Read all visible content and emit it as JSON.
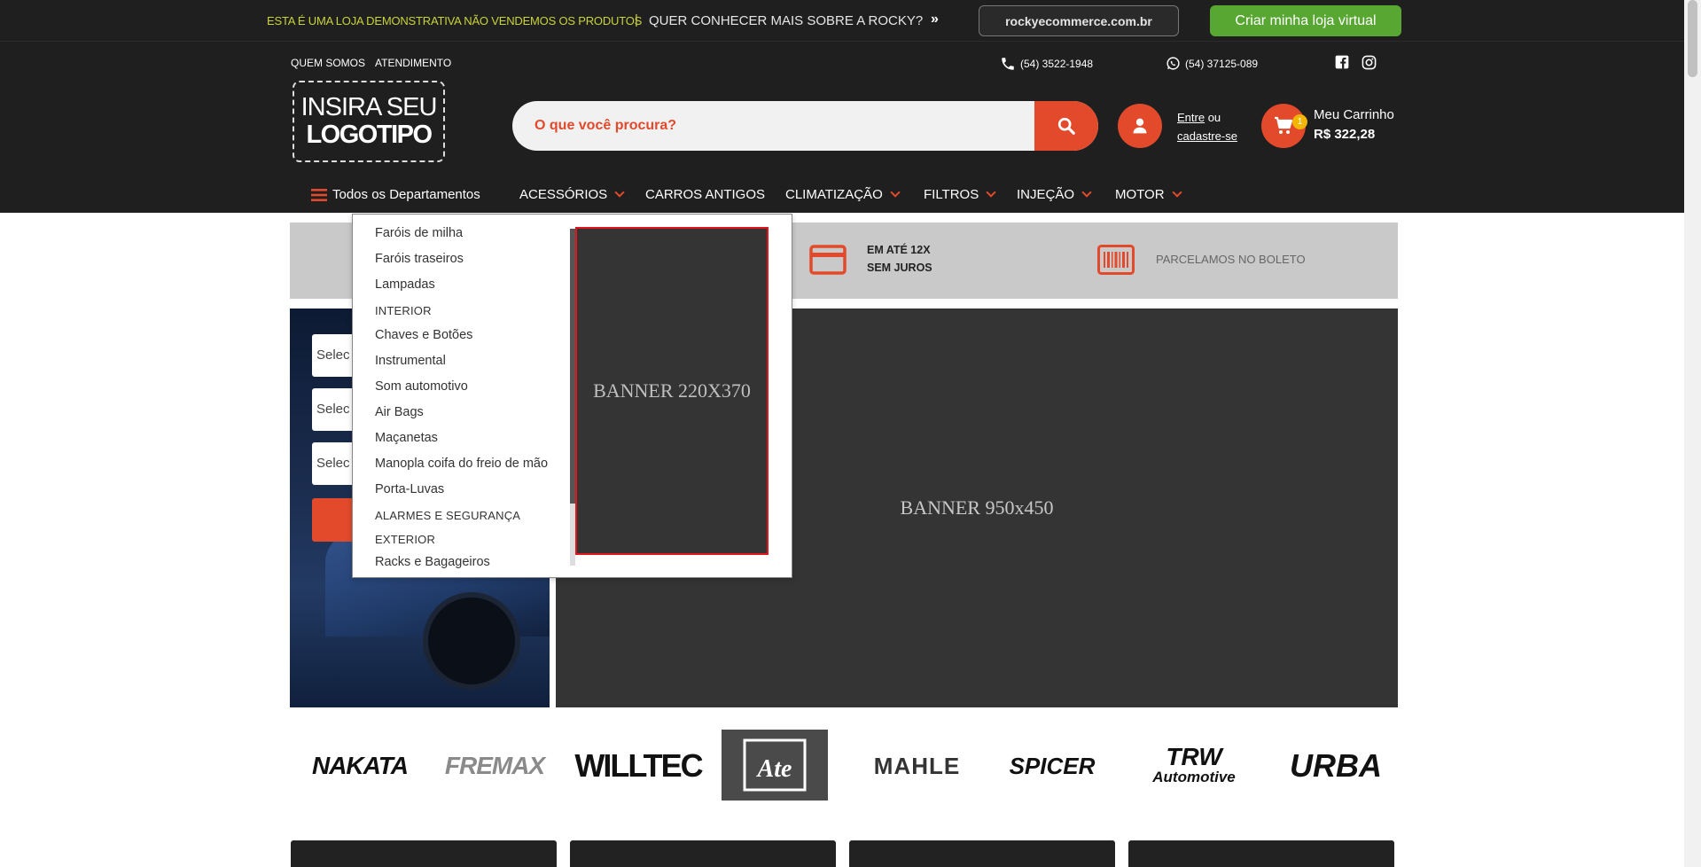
{
  "notice": {
    "demo_text": "ESTA É UMA LOJA DEMONSTRATIVA NÃO VENDEMOS OS PRODUTOS",
    "separator": "|",
    "more_text": "QUER CONHECER MAIS SOBRE A ROCKY?",
    "arrows": "»",
    "url_button": "rockyecommerce.com.br",
    "cta_button": "Criar minha loja virtual"
  },
  "utility": {
    "about": "QUEM SOMOS",
    "support": "ATENDIMENTO",
    "phone": "(54) 3522-1948",
    "whatsapp": "(54) 37125-089"
  },
  "logo": {
    "line1": "INSIRA SEU",
    "line2": "LOGOTIPO"
  },
  "search": {
    "placeholder": "O que você procura?"
  },
  "account": {
    "login": "Entre",
    "or": " ou",
    "register": "cadastre-se"
  },
  "cart": {
    "title": "Meu Carrinho",
    "total": "R$ 322,28",
    "count": "1"
  },
  "nav": {
    "all_departments": "Todos os Departamentos",
    "items": [
      {
        "label": "ACESSÓRIOS",
        "has_dropdown": true
      },
      {
        "label": "CARROS ANTIGOS",
        "has_dropdown": false
      },
      {
        "label": "CLIMATIZAÇÃO",
        "has_dropdown": true
      },
      {
        "label": "FILTROS",
        "has_dropdown": true
      },
      {
        "label": "INJEÇÃO",
        "has_dropdown": true
      },
      {
        "label": "MOTOR",
        "has_dropdown": true
      }
    ]
  },
  "dropdown": {
    "items": [
      {
        "label": "Faróis de milha",
        "type": "item"
      },
      {
        "label": "Faróis traseiros",
        "type": "item"
      },
      {
        "label": "Lampadas",
        "type": "item"
      },
      {
        "label": "INTERIOR",
        "type": "category"
      },
      {
        "label": "Chaves e Botões",
        "type": "item"
      },
      {
        "label": "Instrumental",
        "type": "item"
      },
      {
        "label": "Som automotivo",
        "type": "item"
      },
      {
        "label": "Air Bags",
        "type": "item"
      },
      {
        "label": "Maçanetas",
        "type": "item"
      },
      {
        "label": "Manopla coifa do freio de mão",
        "type": "item"
      },
      {
        "label": "Porta-Luvas",
        "type": "item"
      },
      {
        "label": "ALARMES E SEGURANÇA",
        "type": "category"
      },
      {
        "label": "EXTERIOR",
        "type": "category"
      },
      {
        "label": "Racks e Bagageiros",
        "type": "item"
      }
    ],
    "banner": "BANNER 220X370"
  },
  "benefits": {
    "installments_line1": "EM ATÉ 12X",
    "installments_line2": "SEM JUROS",
    "boleto": "PARCELAMOS NO BOLETO"
  },
  "filter": {
    "select1": "Selec",
    "select2": "Selec",
    "select3": "Selec"
  },
  "main_banner": "BANNER 950x450",
  "brands": {
    "nakata": "NAKATA",
    "fremax": "FREMAX",
    "willtec": "WILLTEC",
    "ate": "Ate",
    "mahle": "MAHLE",
    "spicer": "SPICER",
    "trw_1": "TRW",
    "trw_2": "Automotive",
    "urba": "URBA"
  },
  "colors": {
    "accent": "#e24a2b",
    "header_bg": "#1f1f1f",
    "cta_green": "#58a733",
    "notice_yellow": "#c9d33a",
    "banner_bg": "#343434"
  }
}
